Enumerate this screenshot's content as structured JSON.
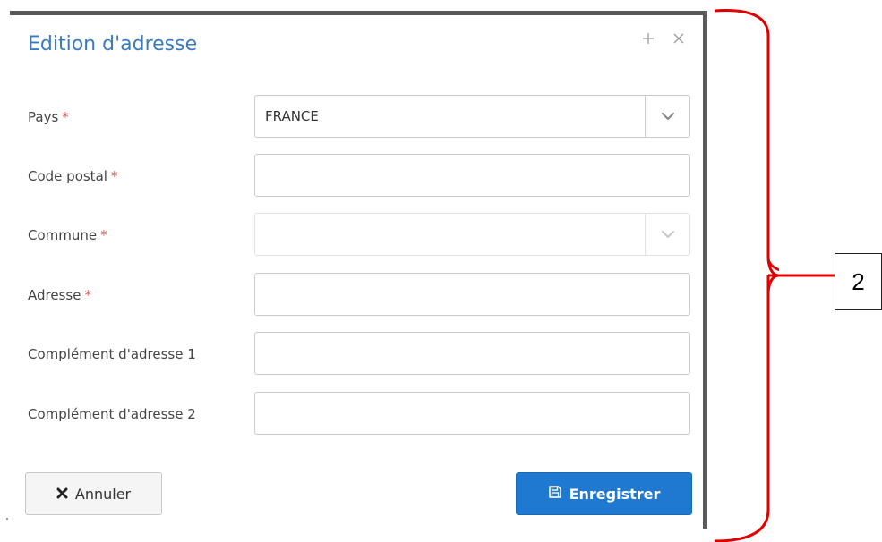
{
  "dialog": {
    "title": "Edition d'adresse",
    "icons": [
      "plus-icon",
      "close-icon"
    ]
  },
  "form": {
    "required_marker": "*",
    "fields": [
      {
        "label": "Pays",
        "required": true,
        "type": "select",
        "value": "FRANCE",
        "disabled": false
      },
      {
        "label": "Code postal",
        "required": true,
        "type": "text",
        "value": ""
      },
      {
        "label": "Commune",
        "required": true,
        "type": "select",
        "value": "",
        "disabled": true
      },
      {
        "label": "Adresse",
        "required": true,
        "type": "text",
        "value": ""
      },
      {
        "label": "Complément d'adresse 1",
        "required": false,
        "type": "text",
        "value": ""
      },
      {
        "label": "Complément d'adresse 2",
        "required": false,
        "type": "text",
        "value": ""
      }
    ]
  },
  "buttons": {
    "cancel_label": "Annuler",
    "cancel_icon": "times-icon",
    "save_label": "Enregistrer",
    "save_icon": "floppy-disk-icon"
  },
  "annotation": {
    "label": "2",
    "color": "#e00000"
  },
  "colors": {
    "title": "#3a7bbf",
    "required": "#d9534f",
    "primary_button": "#1f79d0"
  }
}
